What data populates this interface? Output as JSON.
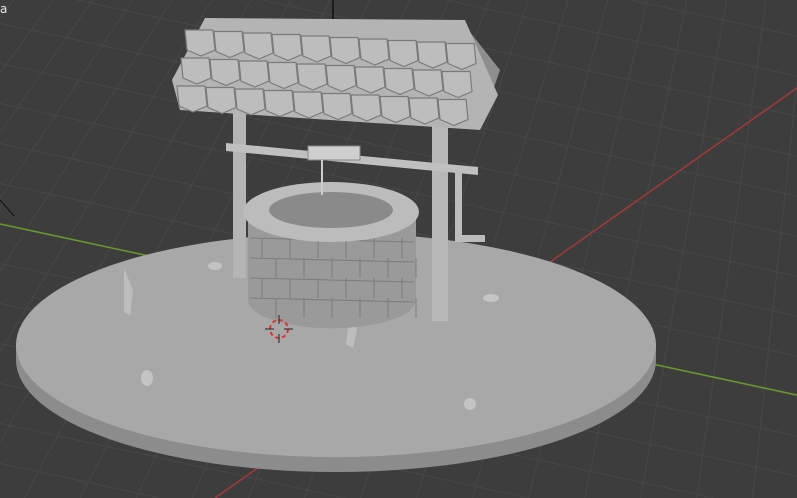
{
  "viewport": {
    "overlay_label": "a",
    "colors": {
      "background": "#3d3d3d",
      "grid": "#474747",
      "x_axis": "#a33a3a",
      "y_axis": "#6a9a2c",
      "model": "#a9a9a9"
    }
  }
}
